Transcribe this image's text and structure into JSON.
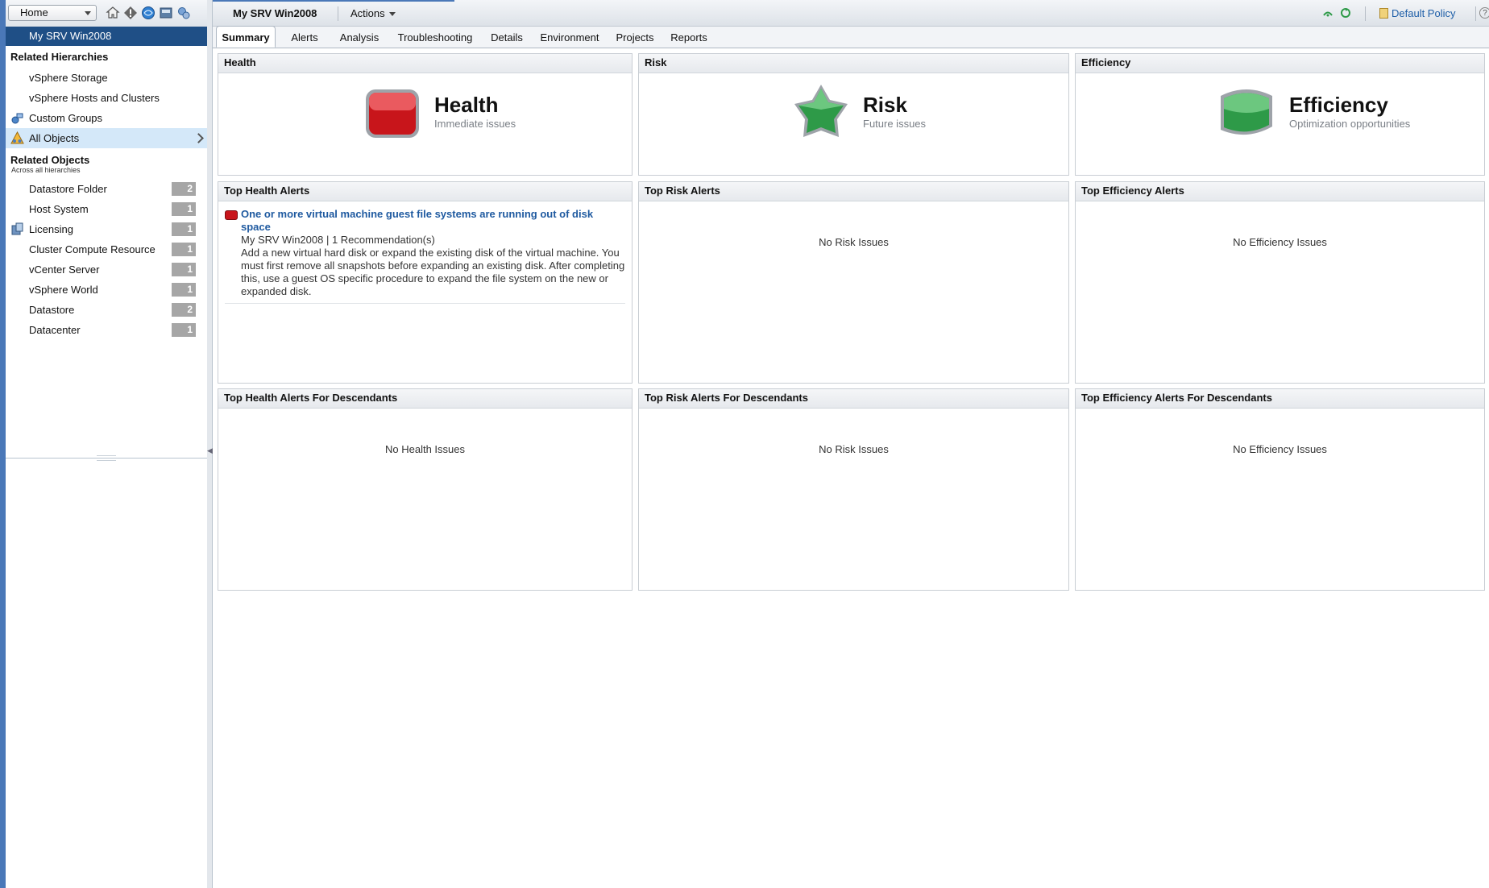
{
  "nav": {
    "home_select": "Home",
    "toolbar_icons": [
      "home-icon",
      "alerts-icon",
      "environment-icon",
      "dashboard-icon",
      "administration-icon"
    ],
    "selected_object": "My SRV Win2008",
    "related_hierarchies": {
      "title": "Related Hierarchies",
      "items": [
        {
          "label": "vSphere Storage",
          "icon": "none"
        },
        {
          "label": "vSphere Hosts and Clusters",
          "icon": "none"
        },
        {
          "label": "Custom Groups",
          "icon": "custom-groups-icon"
        },
        {
          "label": "All Objects",
          "icon": "all-objects-icon"
        }
      ]
    },
    "related_objects": {
      "title": "Related Objects",
      "subtitle": "Across all hierarchies",
      "items": [
        {
          "label": "Datastore Folder",
          "count": "2"
        },
        {
          "label": "Host System",
          "count": "1"
        },
        {
          "label": "Licensing",
          "count": "1"
        },
        {
          "label": "Cluster Compute Resource",
          "count": "1"
        },
        {
          "label": "vCenter Server",
          "count": "1"
        },
        {
          "label": "vSphere World",
          "count": "1"
        },
        {
          "label": "Datastore",
          "count": "2"
        },
        {
          "label": "Datacenter",
          "count": "1"
        }
      ]
    }
  },
  "header": {
    "object_title": "My SRV Win2008",
    "actions_label": "Actions",
    "policy_label": "Default Policy",
    "help": "?"
  },
  "tabs": [
    {
      "label": "Summary",
      "active": true
    },
    {
      "label": "Alerts"
    },
    {
      "label": "Analysis"
    },
    {
      "label": "Troubleshooting"
    },
    {
      "label": "Details"
    },
    {
      "label": "Environment"
    },
    {
      "label": "Projects"
    },
    {
      "label": "Reports"
    }
  ],
  "summary": {
    "health": {
      "panel_title": "Health",
      "label": "Health",
      "sub": "Immediate issues",
      "state_color": "#c8151b"
    },
    "risk": {
      "panel_title": "Risk",
      "label": "Risk",
      "sub": "Future issues",
      "state_color": "#2e9a48"
    },
    "efficiency": {
      "panel_title": "Efficiency",
      "label": "Efficiency",
      "sub": "Optimization opportunities",
      "state_color": "#2e9a48"
    }
  },
  "top_alerts": {
    "health": {
      "title": "Top Health Alerts",
      "alert": {
        "title": "One or more virtual machine guest file systems are running out of disk space",
        "meta": "My SRV Win2008 | 1 Recommendation(s)",
        "description": "Add a new virtual hard disk or expand the existing disk of the virtual machine. You must first remove all snapshots before expanding an existing disk. After completing this, use a guest OS specific procedure to expand the file system on the new or expanded disk."
      }
    },
    "risk": {
      "title": "Top Risk Alerts",
      "empty": "No Risk Issues"
    },
    "efficiency": {
      "title": "Top Efficiency Alerts",
      "empty": "No Efficiency Issues"
    }
  },
  "descendant_alerts": {
    "health": {
      "title": "Top Health Alerts For Descendants",
      "empty": "No Health Issues"
    },
    "risk": {
      "title": "Top Risk Alerts For Descendants",
      "empty": "No Risk Issues"
    },
    "efficiency": {
      "title": "Top Efficiency Alerts For Descendants",
      "empty": "No Efficiency Issues"
    }
  }
}
